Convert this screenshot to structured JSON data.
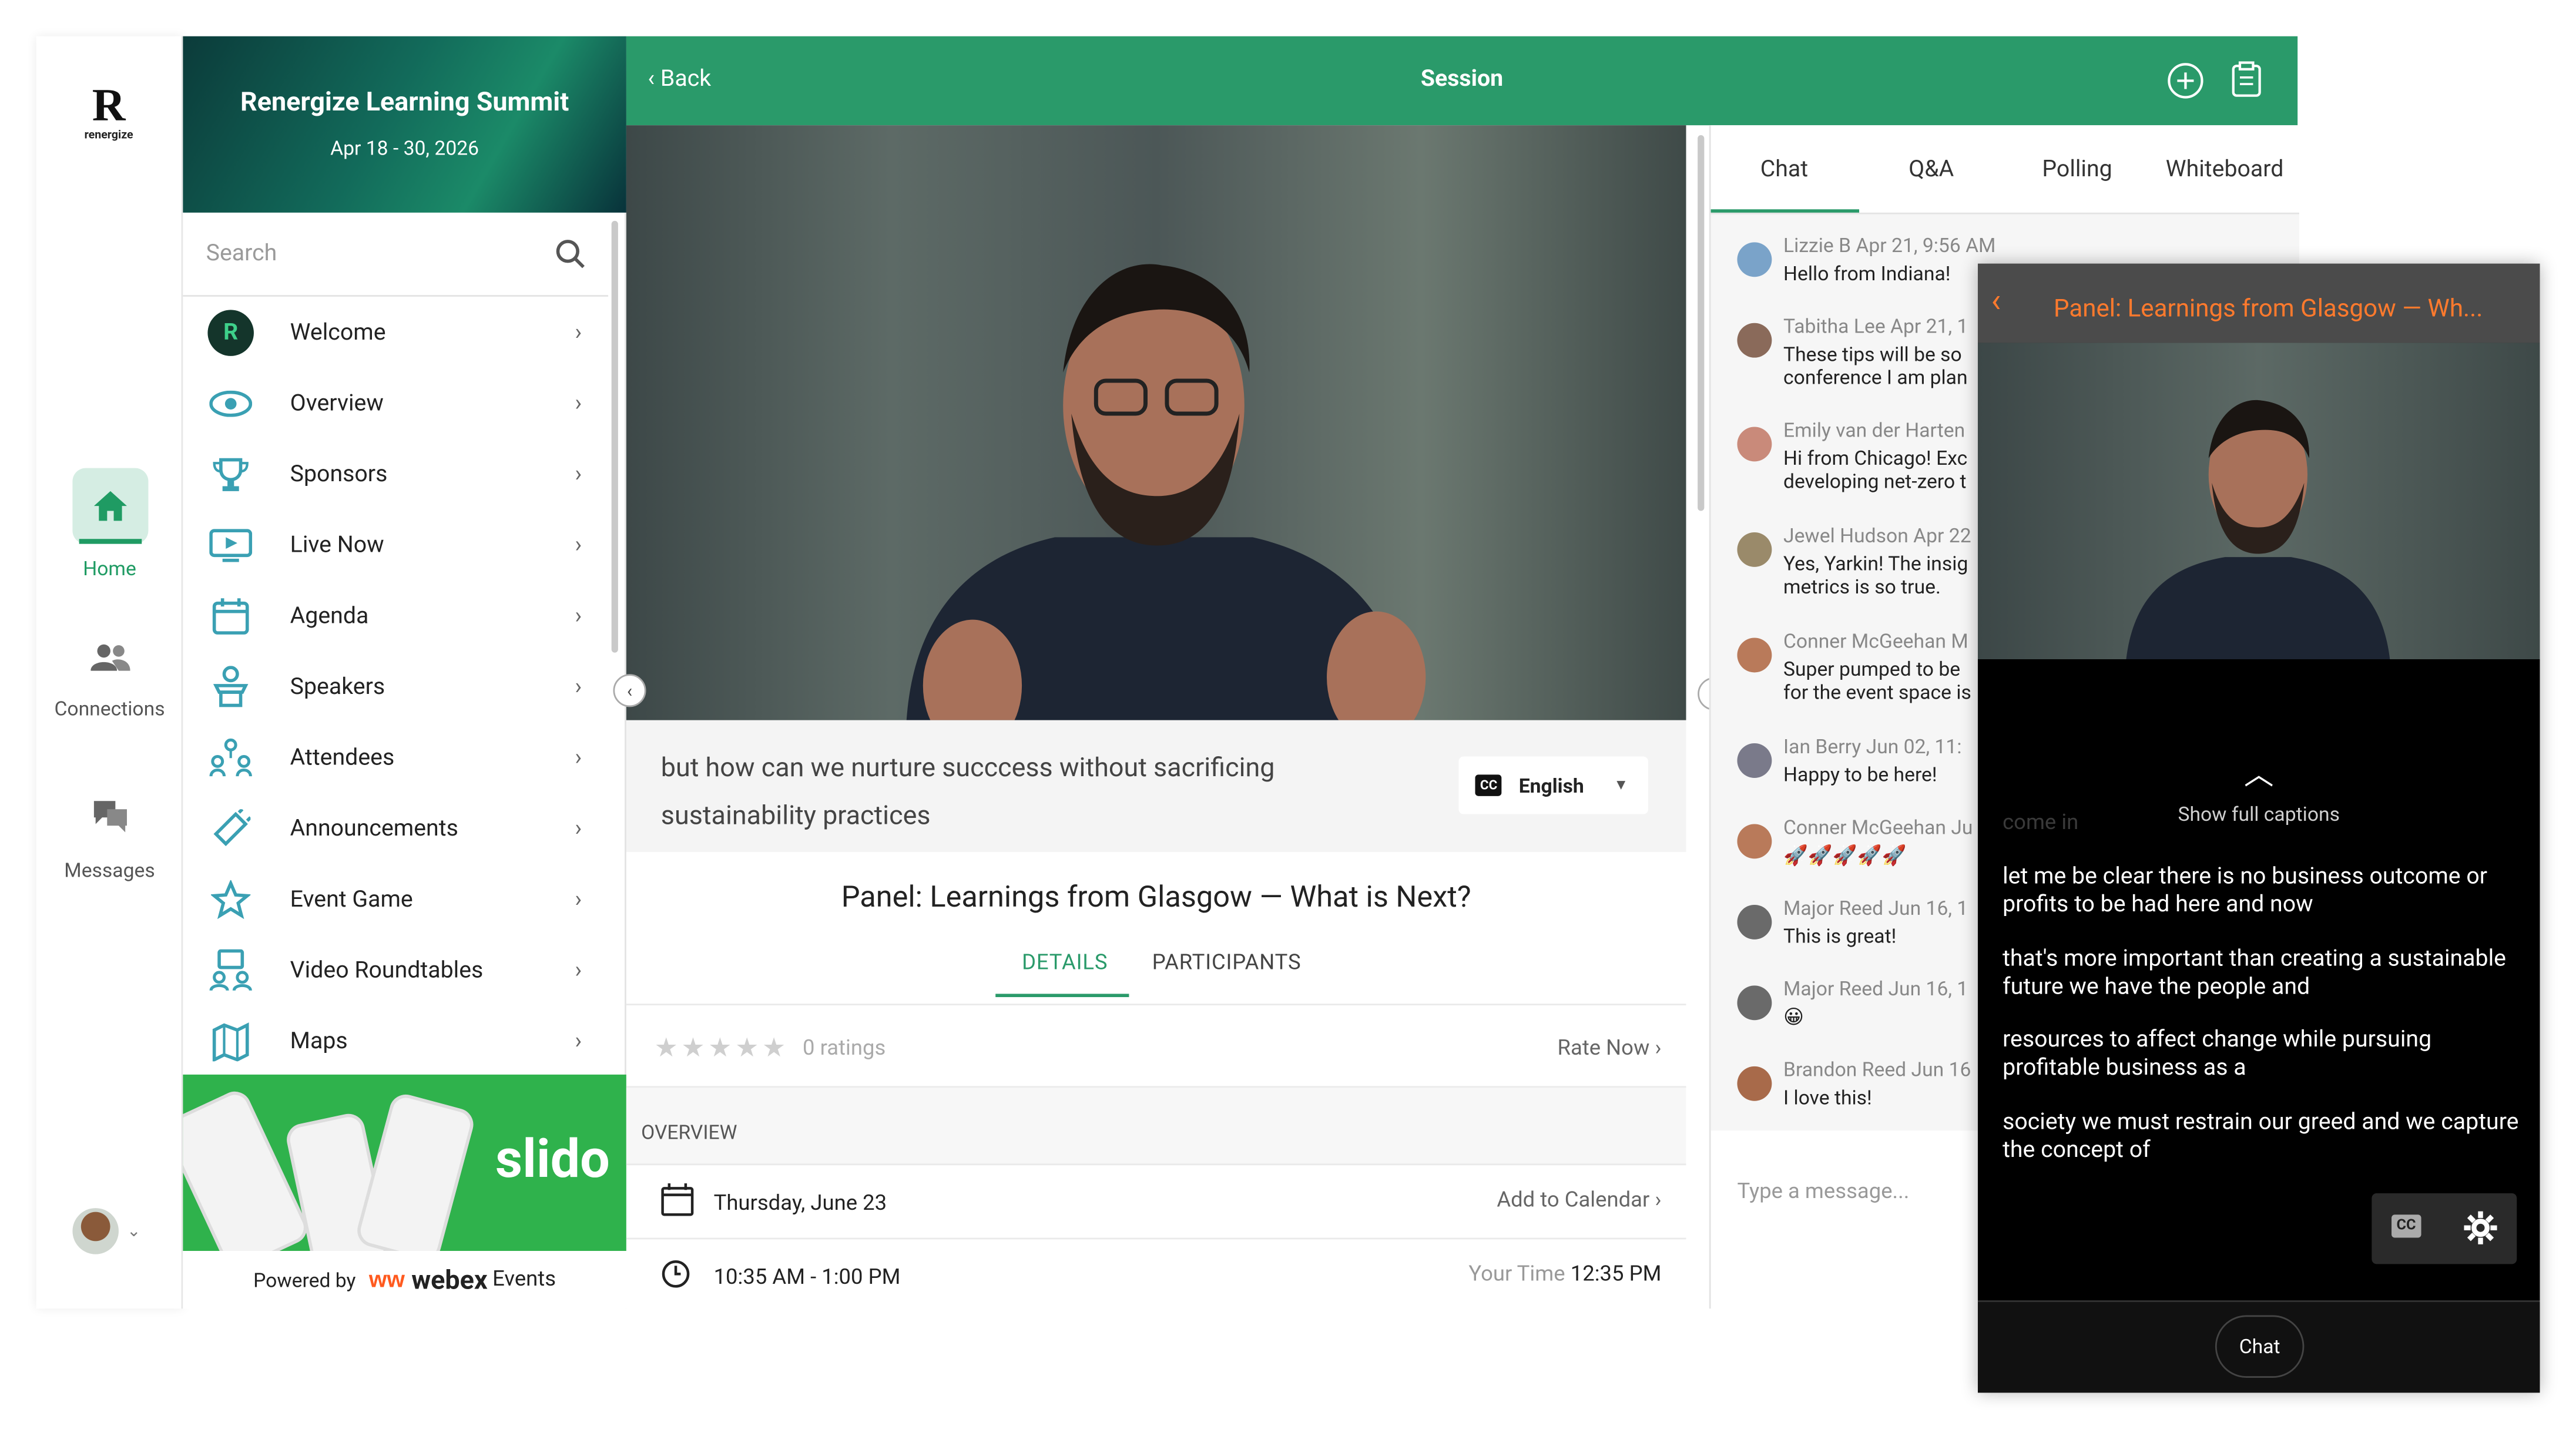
{
  "rail": {
    "logo_text": "renergize",
    "home_label": "Home",
    "connections_label": "Connections",
    "messages_label": "Messages"
  },
  "sidebar": {
    "event_title": "Renergize Learning Summit",
    "event_dates": "Apr 18 - 30, 2026",
    "search_placeholder": "Search",
    "items": [
      {
        "label": "Welcome",
        "icon": "welcome-logo-icon"
      },
      {
        "label": "Overview",
        "icon": "eye-icon"
      },
      {
        "label": "Sponsors",
        "icon": "trophy-icon"
      },
      {
        "label": "Live Now",
        "icon": "live-screen-icon"
      },
      {
        "label": "Agenda",
        "icon": "calendar-icon"
      },
      {
        "label": "Speakers",
        "icon": "podium-icon"
      },
      {
        "label": "Attendees",
        "icon": "people-network-icon"
      },
      {
        "label": "Announcements",
        "icon": "megaphone-icon"
      },
      {
        "label": "Event Game",
        "icon": "star-icon"
      },
      {
        "label": "Video Roundtables",
        "icon": "roundtable-icon"
      },
      {
        "label": "Maps",
        "icon": "map-icon"
      }
    ],
    "sponsor_word": "slido",
    "powered_by": "Powered by",
    "powered_brand": "webex",
    "powered_brand_suffix": "Events"
  },
  "header": {
    "back_label": "Back",
    "title": "Session"
  },
  "session": {
    "caption_text": "but how can we nurture succcess without sacrificing sustainability practices",
    "cc_label": "CC",
    "language": "English",
    "title": "Panel: Learnings from Glasgow — What is Next?",
    "tabs": [
      "DETAILS",
      "PARTICIPANTS"
    ],
    "ratings_text": "0 ratings",
    "rate_now": "Rate Now",
    "overview_label": "OVERVIEW",
    "date": "Thursday, June 23",
    "add_to_calendar": "Add to Calendar",
    "time_range": "10:35 AM - 1:00 PM",
    "your_time_label": "Your Time",
    "your_time_value": "12:35 PM"
  },
  "chat": {
    "tabs": [
      "Chat",
      "Q&A",
      "Polling",
      "Whiteboard"
    ],
    "messages": [
      {
        "who": "Lizzie B Apr 21, 9:56 AM",
        "text": "Hello from Indiana!",
        "color": "#7aa3c9"
      },
      {
        "who": "Tabitha Lee Apr 21, 1",
        "text": "These tips will be so conference I am plan",
        "color": "#8a6a5a"
      },
      {
        "who": "Emily van der Harten",
        "text": "Hi from Chicago! Exc developing net-zero t",
        "color": "#c98a7a"
      },
      {
        "who": "Jewel Hudson Apr 22",
        "text": "Yes, Yarkin! The insig metrics is so true.",
        "color": "#9a8a6a"
      },
      {
        "who": "Conner McGeehan M",
        "text": "Super pumped to be for the event space is",
        "color": "#b97a5a"
      },
      {
        "who": "Ian Berry Jun 02, 11:",
        "text": "Happy to be here!",
        "color": "#7a7a8a"
      },
      {
        "who": "Conner McGeehan Ju",
        "text": "🚀🚀🚀🚀🚀",
        "color": "#b97a5a"
      },
      {
        "who": "Major Reed Jun 16, 1",
        "text": "This is great!",
        "color": "#6a6a6a"
      },
      {
        "who": "Major Reed Jun 16, 1",
        "text": "😀",
        "color": "#6a6a6a"
      },
      {
        "who": "Brandon Reed Jun 16",
        "text": "I love this!",
        "color": "#a86a4a"
      }
    ],
    "input_placeholder": "Type a message..."
  },
  "mobile": {
    "title": "Panel: Learnings from Glasgow — Wh...",
    "show_full": "Show full captions",
    "faded": "come in",
    "captions": [
      "let me be clear there is no business outcome or profits to be had here and now",
      "that's more important than creating a sustainable future we have the people and",
      "resources to affect change while pursuing profitable business as a",
      "society we must restrain our greed and we capture the concept of"
    ],
    "cc_label": "CC",
    "footer_button": "Chat"
  },
  "colors": {
    "brand_green": "#2a9a6a",
    "accent_orange": "#ff7a2d",
    "slido_green": "#2fb24c"
  }
}
